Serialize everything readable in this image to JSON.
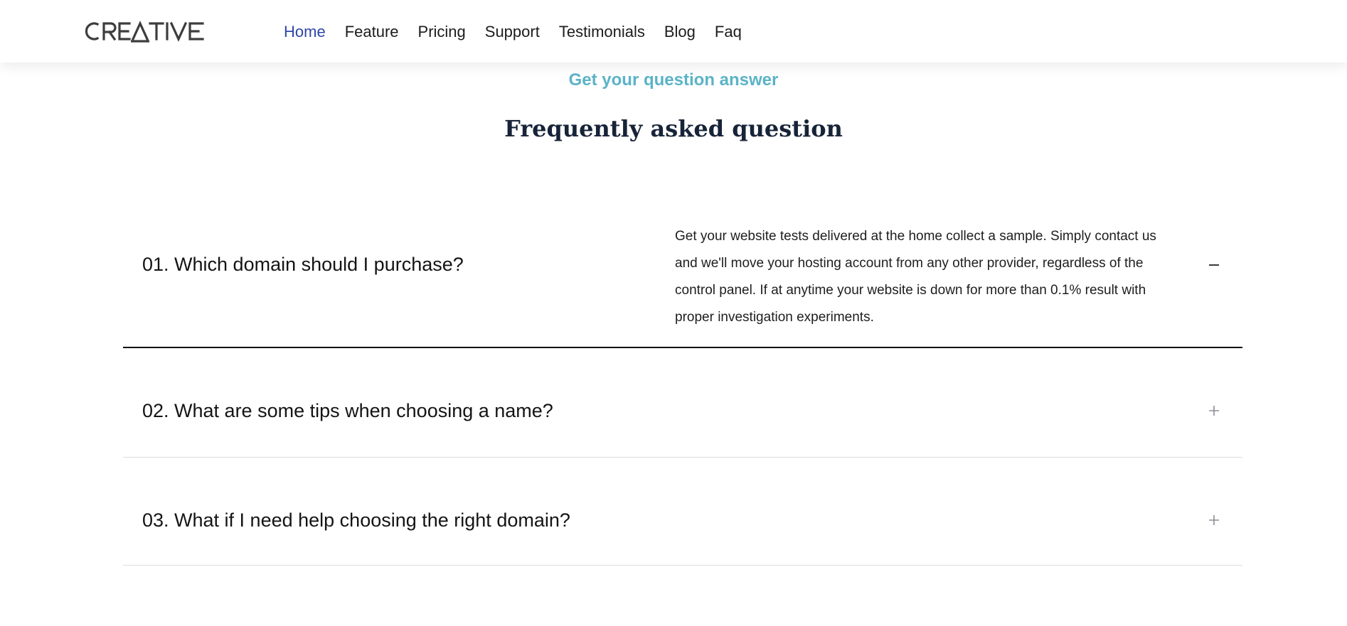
{
  "brand": {
    "logo_text": "CREATIVE"
  },
  "nav": {
    "items": [
      {
        "label": "Home",
        "active": true
      },
      {
        "label": "Feature",
        "active": false
      },
      {
        "label": "Pricing",
        "active": false
      },
      {
        "label": "Support",
        "active": false
      },
      {
        "label": "Testimonials",
        "active": false
      },
      {
        "label": "Blog",
        "active": false
      },
      {
        "label": "Faq",
        "active": false
      }
    ]
  },
  "faq_section": {
    "eyebrow": "Get your question answer",
    "title": "Frequently asked question",
    "items": [
      {
        "question": "01. Which domain should I purchase?",
        "answer": "Get your website tests delivered at the home collect a sample. Simply contact us and we'll move your hosting account from any other provider, regardless of the control panel. If at anytime your website is down for more than 0.1% result with proper investigation experiments.",
        "expanded": true,
        "toggle_icon": "minus-icon"
      },
      {
        "question": "02. What are some tips when choosing a name?",
        "expanded": false,
        "toggle_icon": "plus-icon"
      },
      {
        "question": "03. What if I need help choosing the right domain?",
        "expanded": false,
        "toggle_icon": "plus-icon"
      }
    ]
  },
  "colors": {
    "nav_active": "#2f46a8",
    "eyebrow": "#5bb3c7",
    "title": "#172338",
    "divider_open": "#111111",
    "divider_closed": "#d9dde1",
    "icon_muted": "#8a8f96"
  }
}
